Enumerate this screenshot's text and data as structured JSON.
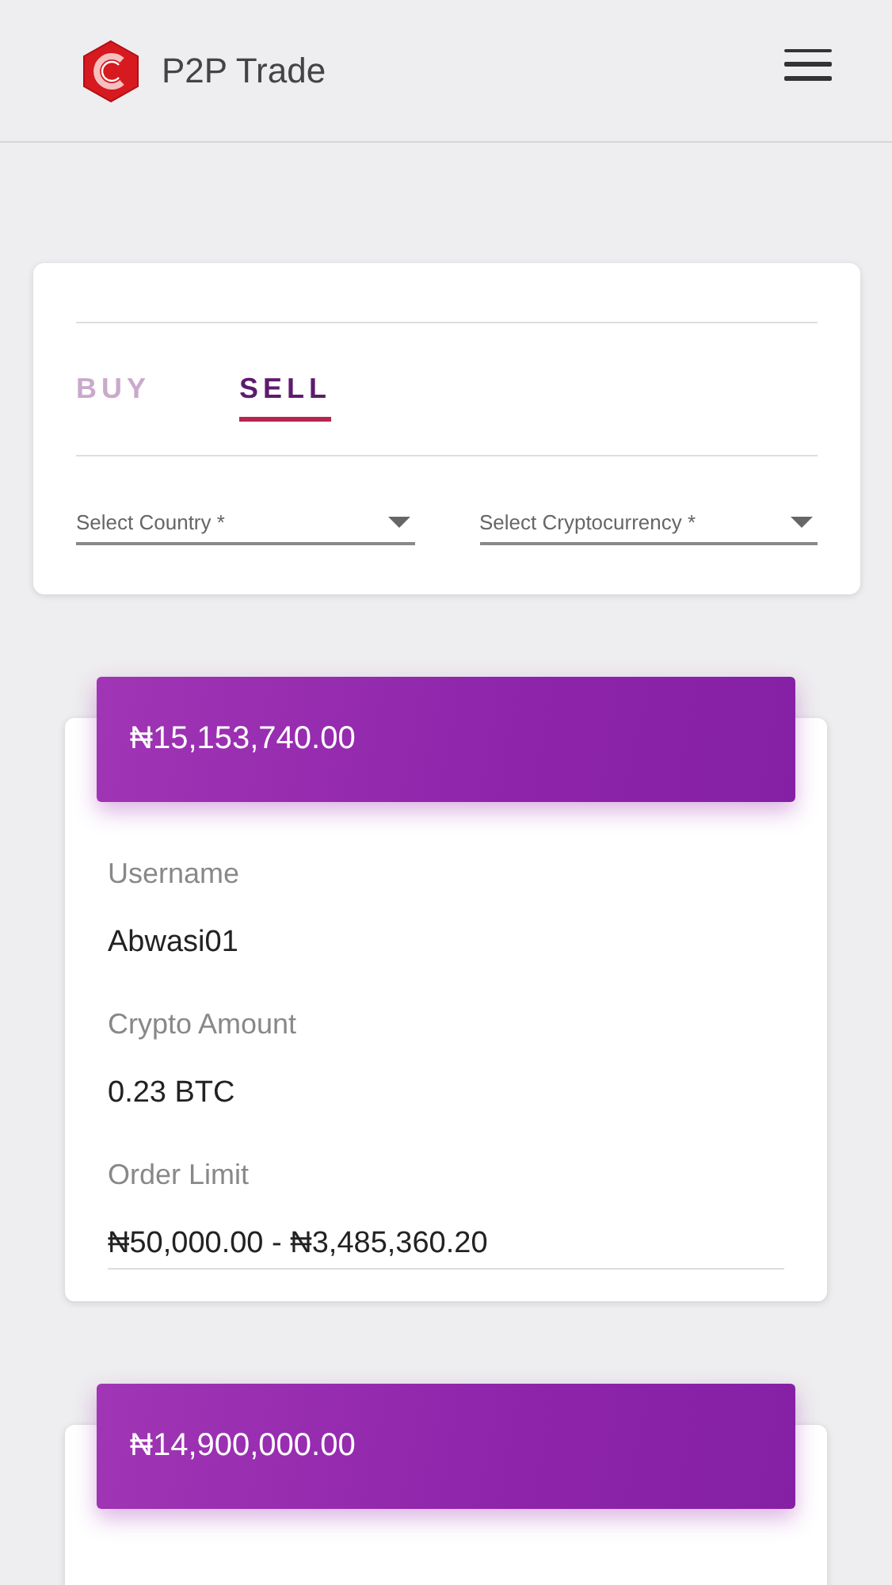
{
  "header": {
    "title": "P2P Trade"
  },
  "filter": {
    "tabs": [
      {
        "label": "BUY",
        "selected": false
      },
      {
        "label": "SELL",
        "selected": true
      }
    ],
    "dropdowns": [
      {
        "placeholder": "Select Country *"
      },
      {
        "placeholder": "Select Cryptocurrency *"
      }
    ]
  },
  "offers": [
    {
      "price": "₦15,153,740.00",
      "fields": [
        {
          "label": "Username",
          "value": "Abwasi01"
        },
        {
          "label": "Crypto Amount",
          "value": "0.23 BTC"
        },
        {
          "label": "Order Limit",
          "value": "₦50,000.00 - ₦3,485,360.20"
        }
      ]
    },
    {
      "price": "₦14,900,000.00"
    }
  ]
}
